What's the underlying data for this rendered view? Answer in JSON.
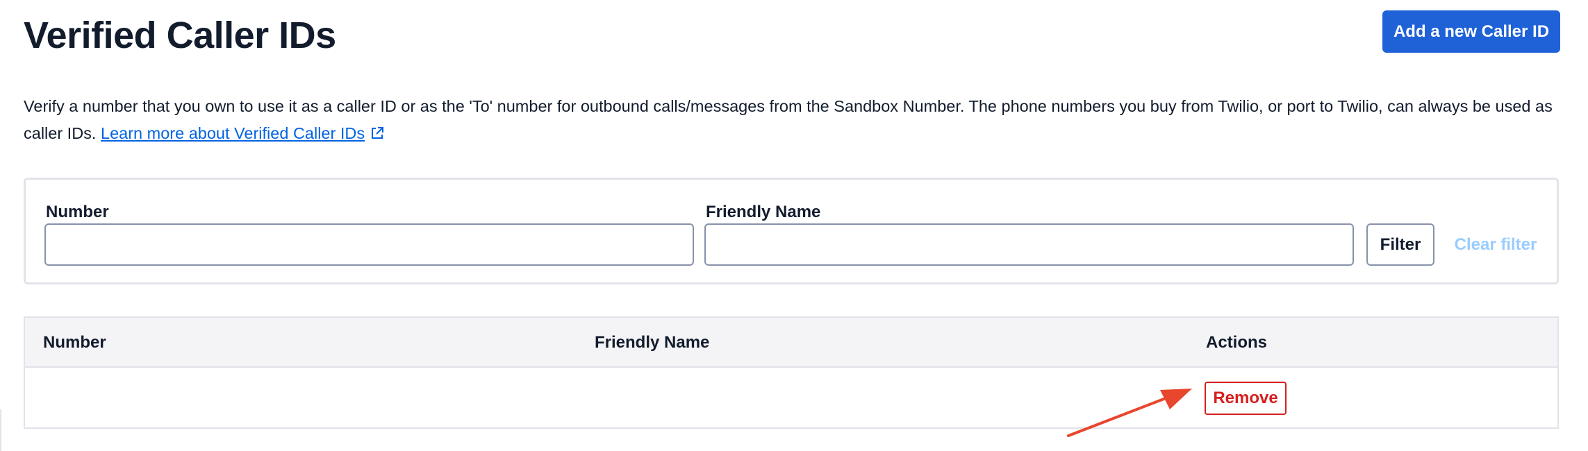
{
  "header": {
    "title": "Verified Caller IDs",
    "add_button_label": "Add a new Caller ID"
  },
  "description": {
    "text": "Verify a number that you own to use it as a caller ID or as the 'To' number for outbound calls/messages from the Sandbox Number. The phone numbers you buy from Twilio, or port to Twilio, can always be used as caller IDs.",
    "link_text": "Learn more about Verified Caller IDs",
    "link_icon": "external-link-icon"
  },
  "filter": {
    "number_label": "Number",
    "number_value": "",
    "friendly_name_label": "Friendly Name",
    "friendly_name_value": "",
    "filter_button_label": "Filter",
    "clear_filter_label": "Clear filter"
  },
  "table": {
    "columns": [
      "Number",
      "Friendly Name",
      "Actions"
    ],
    "rows": [
      {
        "number": "",
        "friendly_name": "",
        "action_label": "Remove"
      }
    ]
  },
  "annotation": {
    "arrow_color": "#e8462d",
    "arrow_target": "remove-button"
  },
  "colors": {
    "primary": "#1f62d8",
    "link": "#0263e0",
    "destructive": "#d61f1f",
    "disabled_link": "#99cdff",
    "text": "#121c2d",
    "border": "#e1e3ea"
  }
}
